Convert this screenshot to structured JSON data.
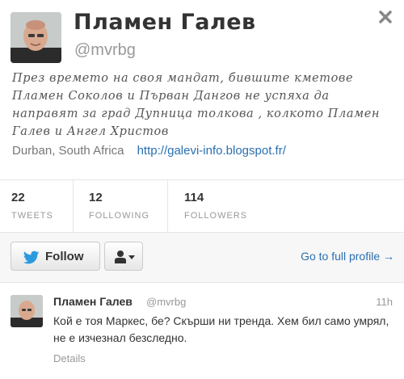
{
  "profile": {
    "name": "Пламен Галев",
    "handle": "@mvrbg",
    "bio": "През времето на своя мандат, бившите кметове Пламен Соколов и Първан Дангов не успяха да направят за град Дупница толкова , колкото Пламен Галев и Ангел Христов",
    "location": "Durban, South Africa",
    "url": "http://galevi-info.blogspot.fr/",
    "avatar_icon": "user-photo",
    "close_icon": "close-icon"
  },
  "stats": [
    {
      "value": "22",
      "label": "TWEETS"
    },
    {
      "value": "12",
      "label": "FOLLOWING"
    },
    {
      "value": "114",
      "label": "FOLLOWERS"
    }
  ],
  "actions": {
    "follow_label": "Follow",
    "follow_icon": "bird-icon",
    "user_menu_icon": "person-icon",
    "full_profile_label": "Go to full profile →"
  },
  "tweet": {
    "author": "Пламен Галев",
    "handle": "@mvrbg",
    "time": "11h",
    "text": "Кой е тоя Маркес, бе? Скърши ни тренда. Хем бил само умрял, не е изчезнал безследно.",
    "details_label": "Details"
  },
  "colors": {
    "link": "#2a6fb0",
    "muted": "#999999",
    "text": "#333333"
  }
}
